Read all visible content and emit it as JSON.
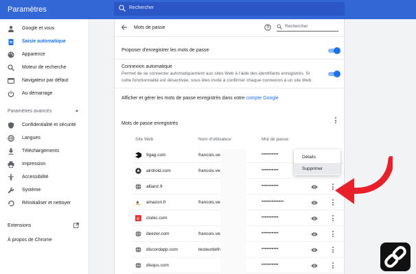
{
  "app": {
    "title": "Paramètres"
  },
  "search": {
    "placeholder": "Rechercher"
  },
  "sidebar": {
    "items": [
      {
        "label": "Google et vous",
        "icon": "person-icon"
      },
      {
        "label": "Saisie automatique",
        "icon": "clipboard-icon",
        "active": true
      },
      {
        "label": "Apparence",
        "icon": "palette-icon"
      },
      {
        "label": "Moteur de recherche",
        "icon": "search-icon"
      },
      {
        "label": "Navigateur par défaut",
        "icon": "browser-icon"
      },
      {
        "label": "Au démarrage",
        "icon": "power-icon"
      }
    ],
    "advanced_header": "Paramètres avancés",
    "advanced_items": [
      {
        "label": "Confidentialité et sécurité",
        "icon": "shield-icon"
      },
      {
        "label": "Langues",
        "icon": "globe-icon"
      },
      {
        "label": "Téléchargements",
        "icon": "download-icon"
      },
      {
        "label": "Impression",
        "icon": "printer-icon"
      },
      {
        "label": "Accessibilité",
        "icon": "accessibility-icon"
      },
      {
        "label": "Système",
        "icon": "wrench-icon"
      },
      {
        "label": "Réinitialiser et nettoyer",
        "icon": "restore-icon"
      }
    ],
    "extensions": "Extensions",
    "about": "À propos de Chrome"
  },
  "passwords": {
    "title": "Mots de passe",
    "search_placeholder": "Rechercher",
    "offer_save": "Proposer d'enregistrer les mots de passe",
    "auto_signin_title": "Connexion automatique",
    "auto_signin_desc": "Permet de se connecter automatiquement aux sites Web à l'aide des identifiants enregistrés. Si cette fonctionnalité est désactivée, vous êtes invité à confirmer chaque connexion à un site Web.",
    "manage_text": "Afficher et gérer les mots de passe enregistrés dans votre ",
    "manage_link": "compte Google",
    "saved_header": "Mots de passe enregistrés",
    "col_site": "Site Web",
    "col_user": "Nom d'utilisateur",
    "col_pass": "Mot de passe",
    "rows": [
      {
        "site": "9gag.com",
        "user": "francois.verri",
        "pass": "••••••••••",
        "icon": "9gag-icon"
      },
      {
        "site": "airdroid.com",
        "user": "francois.verri",
        "pass": "••••••••••",
        "icon": "airdroid-icon"
      },
      {
        "site": "allianz.fr",
        "user": "",
        "pass": "••••••••••",
        "icon": "globe-icon"
      },
      {
        "site": "amazon.fr",
        "user": "francois.verri",
        "pass": "•••••••••••••",
        "icon": "amazon-icon"
      },
      {
        "site": "clubic.com",
        "user": "",
        "pass": "••••••••••",
        "icon": "clubic-icon"
      },
      {
        "site": "deezer.com",
        "user": "francois.verri",
        "pass": "••••••••••",
        "icon": "globe-icon"
      },
      {
        "site": "discordapp.com",
        "user": "testeurdefree",
        "pass": "••••••••••",
        "icon": "globe-icon"
      },
      {
        "site": "disqus.com",
        "user": "",
        "pass": "••••••••••",
        "icon": "globe-icon"
      }
    ],
    "menu": {
      "details": "Détails",
      "delete": "Supprimer"
    }
  },
  "colors": {
    "accent": "#1a73e8",
    "topbar": "#3367d6",
    "arrow": "#e8202a"
  }
}
